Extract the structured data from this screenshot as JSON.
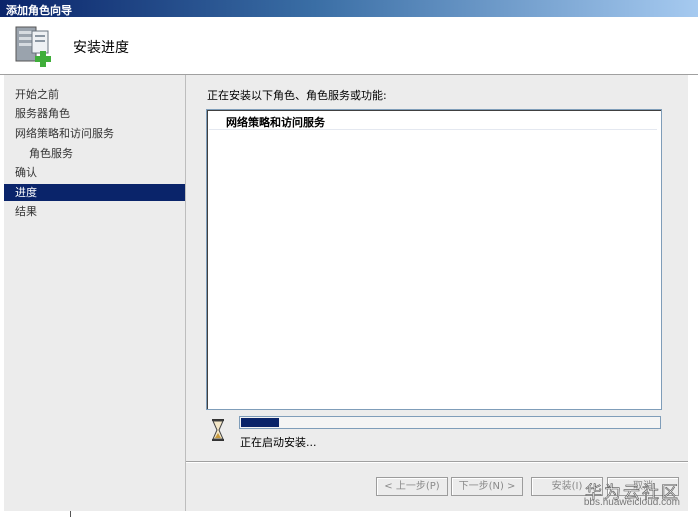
{
  "window": {
    "title": "添加角色向导"
  },
  "header": {
    "heading": "安装进度",
    "icon": "server-role-add-icon"
  },
  "nav": {
    "items": [
      {
        "label": "开始之前",
        "active": false,
        "indent": false
      },
      {
        "label": "服务器角色",
        "active": false,
        "indent": false
      },
      {
        "label": "网络策略和访问服务",
        "active": false,
        "indent": false
      },
      {
        "label": "角色服务",
        "active": false,
        "indent": true
      },
      {
        "label": "确认",
        "active": false,
        "indent": false
      },
      {
        "label": "进度",
        "active": true,
        "indent": false
      },
      {
        "label": "结果",
        "active": false,
        "indent": false
      }
    ]
  },
  "main": {
    "intro": "正在安装以下角色、角色服务或功能:",
    "installing_items": [
      "网络策略和访问服务"
    ],
    "progress": {
      "percent": 9
    },
    "status": "正在启动安装..."
  },
  "buttons": {
    "prev": "< 上一步(P)",
    "next": "下一步(N) >",
    "install": "安装(I)",
    "cancel": "取消"
  },
  "watermark": {
    "text": "华为云社区",
    "url": "bbs.huaweicloud.com"
  },
  "colors": {
    "accent": "#0a246a",
    "pane_bg": "#ececec"
  }
}
